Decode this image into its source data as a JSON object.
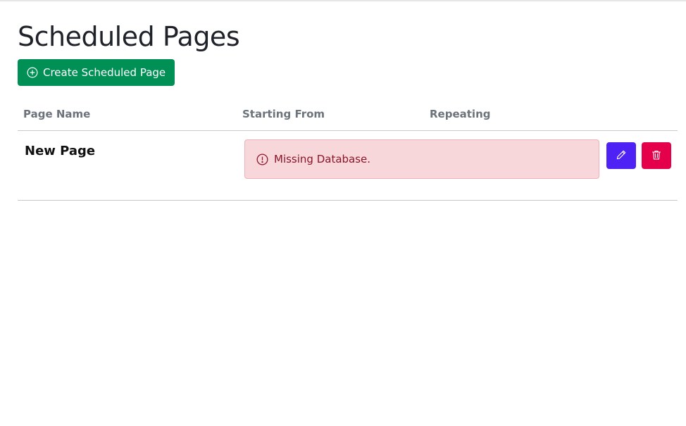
{
  "page": {
    "title": "Scheduled Pages",
    "create_button_label": "Create Scheduled Page"
  },
  "table": {
    "columns": [
      "Page Name",
      "Starting From",
      "Repeating"
    ],
    "rows": [
      {
        "name": "New Page",
        "alert": "Missing Database.",
        "actions": {
          "edit_icon": "pencil-icon",
          "delete_icon": "trash-icon"
        }
      }
    ]
  },
  "colors": {
    "create_button": "#008f54",
    "edit_button": "#4e22f5",
    "delete_button": "#e4004a",
    "alert_background": "#f8d7da",
    "alert_text": "#8a1429",
    "header_text": "#6c737b"
  },
  "icons": {
    "create": "plus-circle-icon",
    "alert": "exclamation-circle-icon"
  }
}
